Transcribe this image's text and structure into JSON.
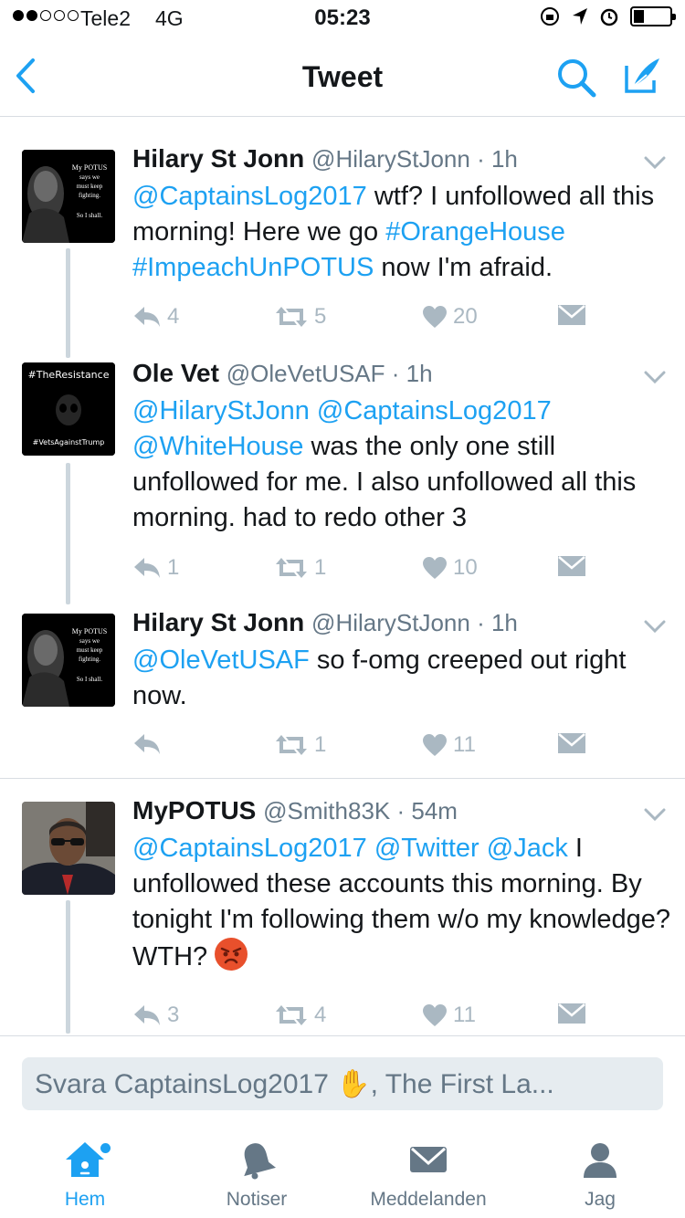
{
  "status_bar": {
    "carrier": "Tele2",
    "network": "4G",
    "time": "05:23"
  },
  "nav": {
    "title": "Tweet"
  },
  "tweets": [
    {
      "avatar_lines": [
        "My POTUS",
        "says we",
        "must keep",
        "fighting.",
        "So I shall."
      ],
      "name": "Hilary St Jonn",
      "handle": "@HilaryStJonn",
      "time": "1h",
      "body": [
        {
          "type": "mention",
          "text": "@CaptainsLog2017"
        },
        {
          "type": "text",
          "text": " wtf? I unfollowed all this morning! Here we go "
        },
        {
          "type": "hashtag",
          "text": "#OrangeHouse"
        },
        {
          "type": "text",
          "text": " "
        },
        {
          "type": "hashtag",
          "text": "#ImpeachUnPOTUS"
        },
        {
          "type": "text",
          "text": " now I'm afraid."
        }
      ],
      "replies": "4",
      "retweets": "5",
      "likes": "20"
    },
    {
      "avatar_lines": [
        "#TheResistance",
        "#VetsAgainstTrump"
      ],
      "name": "Ole Vet",
      "handle": "@OleVetUSAF",
      "time": "1h",
      "body": [
        {
          "type": "mention",
          "text": "@HilaryStJonn"
        },
        {
          "type": "text",
          "text": " "
        },
        {
          "type": "mention",
          "text": "@CaptainsLog2017"
        },
        {
          "type": "text",
          "text": " "
        },
        {
          "type": "mention",
          "text": "@WhiteHouse"
        },
        {
          "type": "text",
          "text": " was the only one still unfollowed for me. I also unfollowed all this morning. had to redo other 3"
        }
      ],
      "replies": "1",
      "retweets": "1",
      "likes": "10"
    },
    {
      "avatar_lines": [
        "My POTUS",
        "says we",
        "must keep",
        "fighting.",
        "So I shall."
      ],
      "name": "Hilary St Jonn",
      "handle": "@HilaryStJonn",
      "time": "1h",
      "body": [
        {
          "type": "mention",
          "text": "@OleVetUSAF"
        },
        {
          "type": "text",
          "text": " so f-omg creeped out right now."
        }
      ],
      "replies": "",
      "retweets": "1",
      "likes": "11"
    },
    {
      "avatar_lines": [],
      "name": "MyPOTUS",
      "handle": "@Smith83K",
      "time": "54m",
      "body": [
        {
          "type": "mention",
          "text": "@CaptainsLog2017"
        },
        {
          "type": "text",
          "text": " "
        },
        {
          "type": "mention",
          "text": "@Twitter"
        },
        {
          "type": "text",
          "text": " "
        },
        {
          "type": "mention",
          "text": "@Jack"
        },
        {
          "type": "text",
          "text": " I unfollowed these accounts this morning. By tonight I'm following them w/o my knowledge? WTH? "
        },
        {
          "type": "emoji",
          "text": "angry-face"
        }
      ],
      "replies": "3",
      "retweets": "4",
      "likes": "11"
    }
  ],
  "reply_box": {
    "text": "Svara CaptainsLog2017 ✋, The First La..."
  },
  "tabs": [
    {
      "label": "Hem",
      "icon": "home-icon",
      "active": true
    },
    {
      "label": "Notiser",
      "icon": "bell-icon",
      "active": false
    },
    {
      "label": "Meddelanden",
      "icon": "envelope-icon",
      "active": false
    },
    {
      "label": "Jag",
      "icon": "person-icon",
      "active": false
    }
  ],
  "colors": {
    "accent": "#1da1f2",
    "muted": "#657786",
    "icon_gray": "#aab8c2"
  }
}
